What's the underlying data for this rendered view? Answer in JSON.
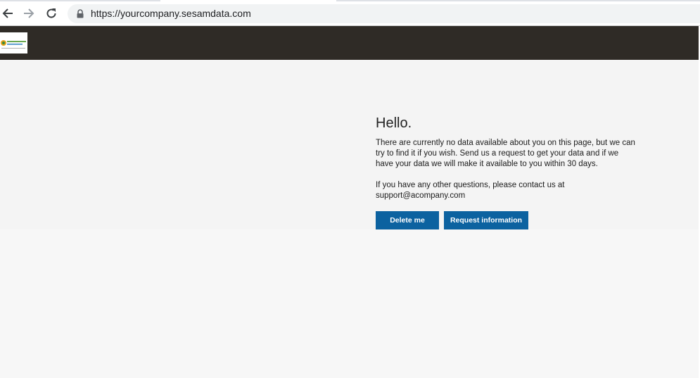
{
  "browser": {
    "url": "https://yourcompany.sesamdata.com",
    "icons": {
      "back": "arrow-left-icon",
      "forward": "arrow-right-icon",
      "reload": "reload-icon",
      "secure": "lock-icon"
    }
  },
  "header": {
    "logo": "company-logo"
  },
  "main": {
    "greeting": "Hello.",
    "message": "There are currently no data available about you on this page, but we can try to find it if you wish. Send us a request to get your data and if we have your data we will make it available to you within 30 days.",
    "contact_line1": "If you have any other questions, please contact us at",
    "contact_line2": "support@acompany.com",
    "buttons": {
      "delete": "Delete me",
      "request": "Request information"
    }
  },
  "colors": {
    "header_bg": "#2f2b26",
    "button_bg": "#0c62a0",
    "page_bg": "#f7f7f7"
  }
}
